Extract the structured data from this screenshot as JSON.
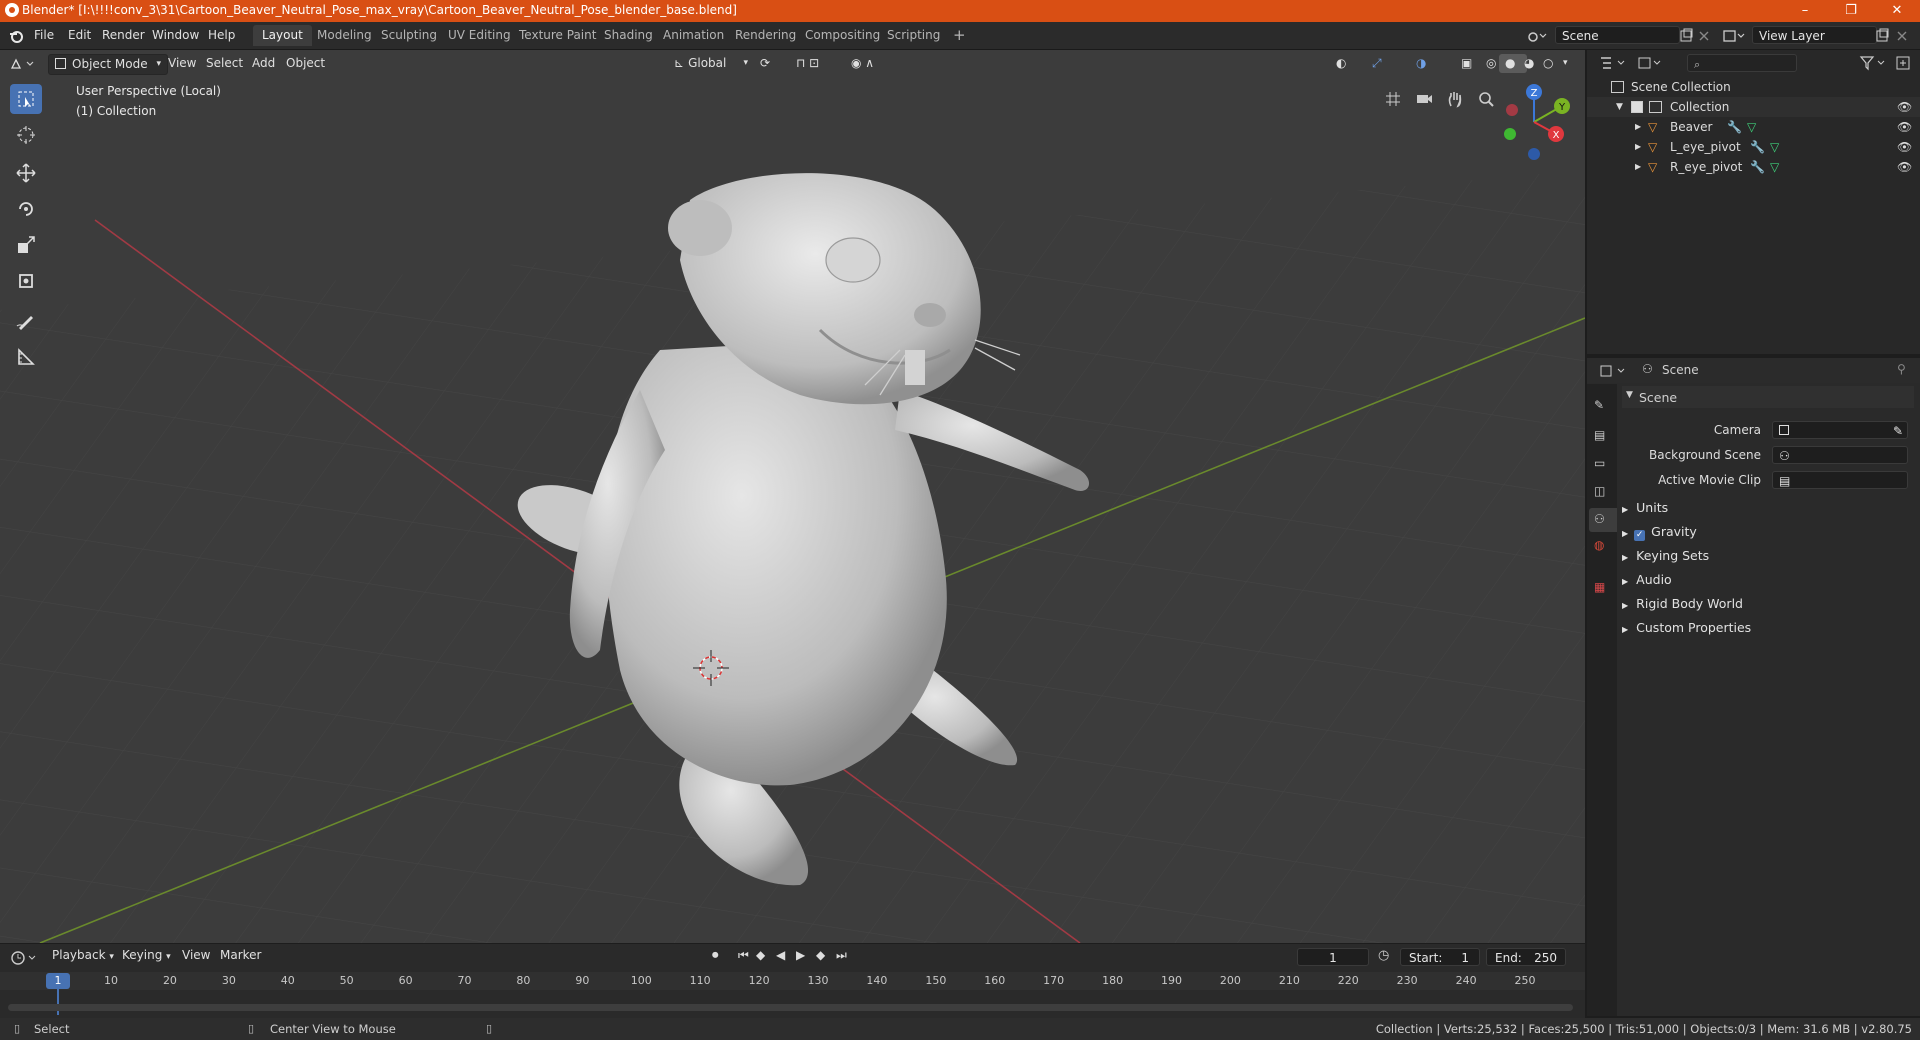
{
  "window": {
    "title": "Blender* [I:\\!!!!conv_3\\31\\Cartoon_Beaver_Neutral_Pose_max_vray\\Cartoon_Beaver_Neutral_Pose_blender_base.blend]",
    "minimize": "–",
    "maximize": "❐",
    "close": "✕"
  },
  "menu": {
    "file": "File",
    "edit": "Edit",
    "render": "Render",
    "window": "Window",
    "help": "Help"
  },
  "workspaces": [
    "Layout",
    "Modeling",
    "Sculpting",
    "UV Editing",
    "Texture Paint",
    "Shading",
    "Animation",
    "Rendering",
    "Compositing",
    "Scripting"
  ],
  "workspace_add": "+",
  "scene_field": "Scene",
  "view_layer_field": "View Layer",
  "viewport": {
    "mode": "Object Mode",
    "menus": {
      "view": "View",
      "select": "Select",
      "add": "Add",
      "object": "Object"
    },
    "transform_orientation": "Global",
    "overlay_line1": "User Perspective (Local)",
    "overlay_line2": "(1) Collection",
    "gizmo_axes": {
      "x": "X",
      "y": "Y",
      "z": "Z"
    },
    "colors": {
      "x_axis": "#a13a44",
      "y_axis": "#6a8a2c",
      "active_tool": "#4772b3"
    }
  },
  "outliner": {
    "root": "Scene Collection",
    "collection": "Collection",
    "objects": [
      "Beaver",
      "L_eye_pivot",
      "R_eye_pivot"
    ]
  },
  "properties": {
    "header": "Scene",
    "panel": "Scene",
    "camera_label": "Camera",
    "background_scene_label": "Background Scene",
    "active_movie_clip_label": "Active Movie Clip",
    "sections": [
      "Units",
      "Gravity",
      "Keying Sets",
      "Audio",
      "Rigid Body World",
      "Custom Properties"
    ],
    "gravity_checked": true
  },
  "timeline": {
    "menus": {
      "playback": "Playback",
      "keying": "Keying",
      "view": "View",
      "marker": "Marker"
    },
    "current_frame": "1",
    "start_label": "Start:",
    "start": "1",
    "end_label": "End:",
    "end": "250",
    "ruler_current": "1",
    "ruler": [
      "10",
      "20",
      "30",
      "40",
      "50",
      "60",
      "70",
      "80",
      "90",
      "100",
      "110",
      "120",
      "130",
      "140",
      "150",
      "160",
      "170",
      "180",
      "190",
      "200",
      "210",
      "220",
      "230",
      "240",
      "250"
    ]
  },
  "status": {
    "left_action": "Select",
    "middle_action": "Center View to Mouse",
    "stats": "Collection | Verts:25,532 | Faces:25,500 | Tris:51,000 | Objects:0/3 | Mem: 31.6 MB | v2.80.75"
  }
}
